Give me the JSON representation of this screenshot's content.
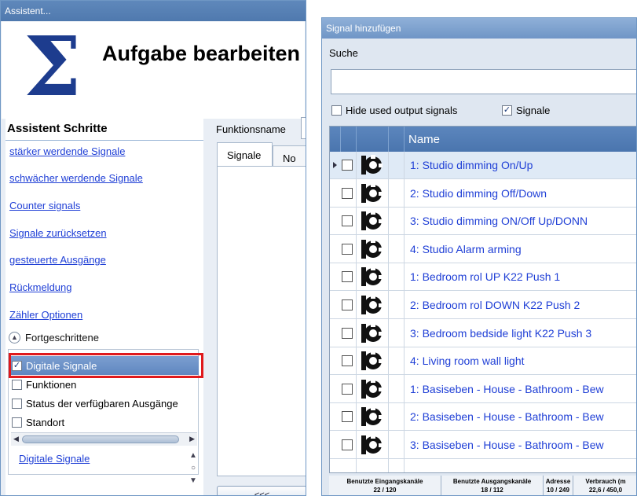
{
  "left_window": {
    "title": "Assistent...",
    "task_title": "Aufgabe bearbeiten",
    "steps_heading": "Assistent Schritte",
    "steps": [
      "stärker werdende Signale",
      "schwächer werdende Signale",
      "Counter signals",
      "Signale zurücksetzen",
      "gesteuerte Ausgänge",
      "Rückmeldung",
      "Zähler Optionen"
    ],
    "advanced_label": "Fortgeschrittene",
    "advanced_options": [
      {
        "label": "Digitale Signale",
        "checked": true,
        "selected": true
      },
      {
        "label": "Funktionen",
        "checked": false,
        "selected": false
      },
      {
        "label": "Status der verfügbaren Ausgänge",
        "checked": false,
        "selected": false
      },
      {
        "label": "Standort",
        "checked": false,
        "selected": false
      }
    ],
    "bottom_link": "Digitale Signale",
    "function_name_label": "Funktionsname",
    "tabs": [
      "Signale",
      "No"
    ],
    "back_button": "<<<"
  },
  "right_window": {
    "title": "Signal hinzufügen",
    "search_label": "Suche",
    "search_value": "",
    "hide_used_label": "Hide used output signals",
    "hide_used_checked": false,
    "signals_label": "Signale",
    "signals_checked": true,
    "grid_header": "Name",
    "rows": [
      {
        "name": "1: Studio dimming On/Up",
        "current": true
      },
      {
        "name": "2: Studio dimming Off/Down",
        "current": false
      },
      {
        "name": "3: Studio dimming ON/Off Up/DONN",
        "current": false
      },
      {
        "name": "4: Studio Alarm arming",
        "current": false
      },
      {
        "name": "1: Bedroom rol UP K22 Push 1",
        "current": false
      },
      {
        "name": "2: Bedroom rol DOWN K22 Push 2",
        "current": false
      },
      {
        "name": "3: Bedroom bedside light K22 Push 3",
        "current": false
      },
      {
        "name": "4: Living room wall light",
        "current": false
      },
      {
        "name": "1: Basiseben - House - Bathroom - Bew",
        "current": false
      },
      {
        "name": "2: Basiseben - House - Bathroom - Bew",
        "current": false
      },
      {
        "name": "3: Basiseben - House - Bathroom - Bew",
        "current": false
      }
    ],
    "status": [
      {
        "header": "Benutzte Eingangskanäle",
        "value": "22 / 120"
      },
      {
        "header": "Benutzte Ausgangskanäle",
        "value": "18 / 112"
      },
      {
        "header": "Adresse",
        "value": "10 / 249"
      },
      {
        "header": "Verbrauch (m",
        "value": "22,6 / 450,0"
      }
    ]
  },
  "colors": {
    "accent_blue": "#4f79ae",
    "link_blue": "#1f3fd6",
    "highlight_red": "#e0191c"
  }
}
